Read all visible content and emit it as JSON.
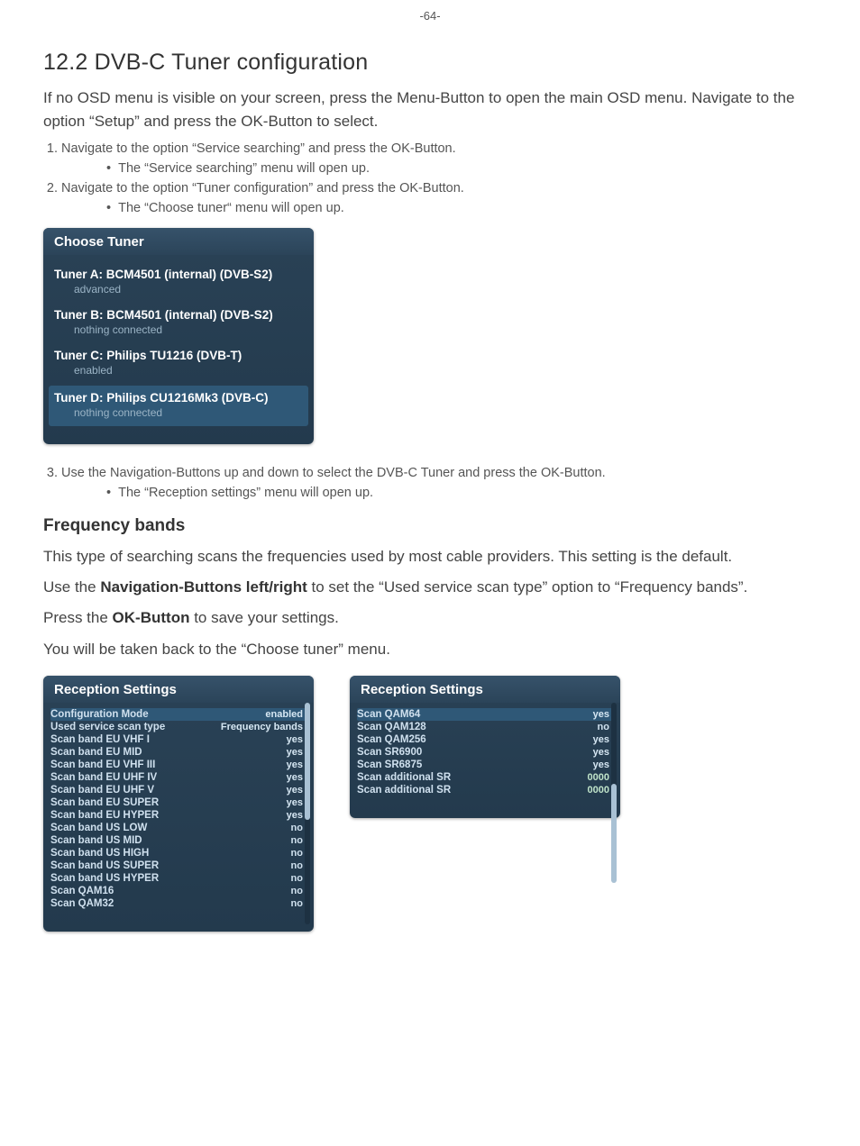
{
  "pageNumber": "-64-",
  "section": {
    "title": "12.2 DVB-C Tuner configuration",
    "intro": "If no OSD menu is visible on your screen, press the Menu-Button to open the main OSD menu. Navigate to the option “Setup” and press the OK-Button to select.",
    "step1": "Navigate to the option “Service searching” and press the OK-Button.",
    "step1b": "The “Service searching” menu will open up.",
    "step2": "Navigate to the option “Tuner configuration” and press the OK-Button.",
    "step2b": "The “Choose tuner“ menu will open up.",
    "step3": "Use the Navigation-Buttons up and down to select the DVB-C Tuner and press the OK-Button.",
    "step3b": "The “Reception settings” menu will open up.",
    "freqTitle": "Frequency bands",
    "freqP1": "This type of searching scans the frequencies used by most cable providers. This setting is the default.",
    "freqP2a": "Use the ",
    "freqP2bold": "Navigation-Buttons left/right",
    "freqP2b": " to set the “Used service scan type” option to “Frequency bands”.",
    "freqP3a": "Press the ",
    "freqP3bold": "OK-Button",
    "freqP3b": " to save your settings.",
    "freqP4": "You will be taken back to the “Choose tuner” menu."
  },
  "osd1": {
    "title": "Choose Tuner",
    "tuners": [
      {
        "main": "Tuner A: BCM4501 (internal) (DVB-S2)",
        "sub": "advanced",
        "sel": false
      },
      {
        "main": "Tuner B: BCM4501 (internal) (DVB-S2)",
        "sub": "nothing connected",
        "sel": false
      },
      {
        "main": "Tuner C: Philips TU1216 (DVB-T)",
        "sub": "enabled",
        "sel": false
      },
      {
        "main": "Tuner D: Philips CU1216Mk3 (DVB-C)",
        "sub": "nothing connected",
        "sel": true
      }
    ]
  },
  "osd2": {
    "title": "Reception Settings",
    "rows": [
      {
        "label": "Configuration Mode",
        "val": "enabled",
        "cls": "yes",
        "hi": true
      },
      {
        "label": "Used service scan type",
        "val": "Frequency bands",
        "cls": "yes"
      },
      {
        "label": "Scan band EU VHF I",
        "val": "yes",
        "cls": "yes"
      },
      {
        "label": "Scan band EU MID",
        "val": "yes",
        "cls": "yes"
      },
      {
        "label": "Scan band EU VHF III",
        "val": "yes",
        "cls": "yes"
      },
      {
        "label": "Scan band EU UHF IV",
        "val": "yes",
        "cls": "yes"
      },
      {
        "label": "Scan band EU UHF V",
        "val": "yes",
        "cls": "yes"
      },
      {
        "label": "Scan band EU SUPER",
        "val": "yes",
        "cls": "yes"
      },
      {
        "label": "Scan band EU HYPER",
        "val": "yes",
        "cls": "yes"
      },
      {
        "label": "Scan band US LOW",
        "val": "no",
        "cls": "no"
      },
      {
        "label": "Scan band US MID",
        "val": "no",
        "cls": "no"
      },
      {
        "label": "Scan band US HIGH",
        "val": "no",
        "cls": "no"
      },
      {
        "label": "Scan band US SUPER",
        "val": "no",
        "cls": "no"
      },
      {
        "label": "Scan band US HYPER",
        "val": "no",
        "cls": "no"
      },
      {
        "label": "Scan QAM16",
        "val": "no",
        "cls": "no"
      },
      {
        "label": "Scan QAM32",
        "val": "no",
        "cls": "no"
      }
    ],
    "thumbTop": "0px",
    "thumbHeight": "130px"
  },
  "osd3": {
    "title": "Reception Settings",
    "rows": [
      {
        "label": "Scan QAM64",
        "val": "yes",
        "cls": "yes",
        "hi": true
      },
      {
        "label": "Scan QAM128",
        "val": "no",
        "cls": "no"
      },
      {
        "label": "Scan QAM256",
        "val": "yes",
        "cls": "yes"
      },
      {
        "label": "Scan SR6900",
        "val": "yes",
        "cls": "yes"
      },
      {
        "label": "Scan SR6875",
        "val": "yes",
        "cls": "yes"
      },
      {
        "label": "Scan additional SR",
        "val": "0000",
        "cls": "num"
      },
      {
        "label": "Scan additional SR",
        "val": "0000",
        "cls": "num"
      }
    ],
    "thumbTop": "90px",
    "thumbHeight": "110px"
  }
}
